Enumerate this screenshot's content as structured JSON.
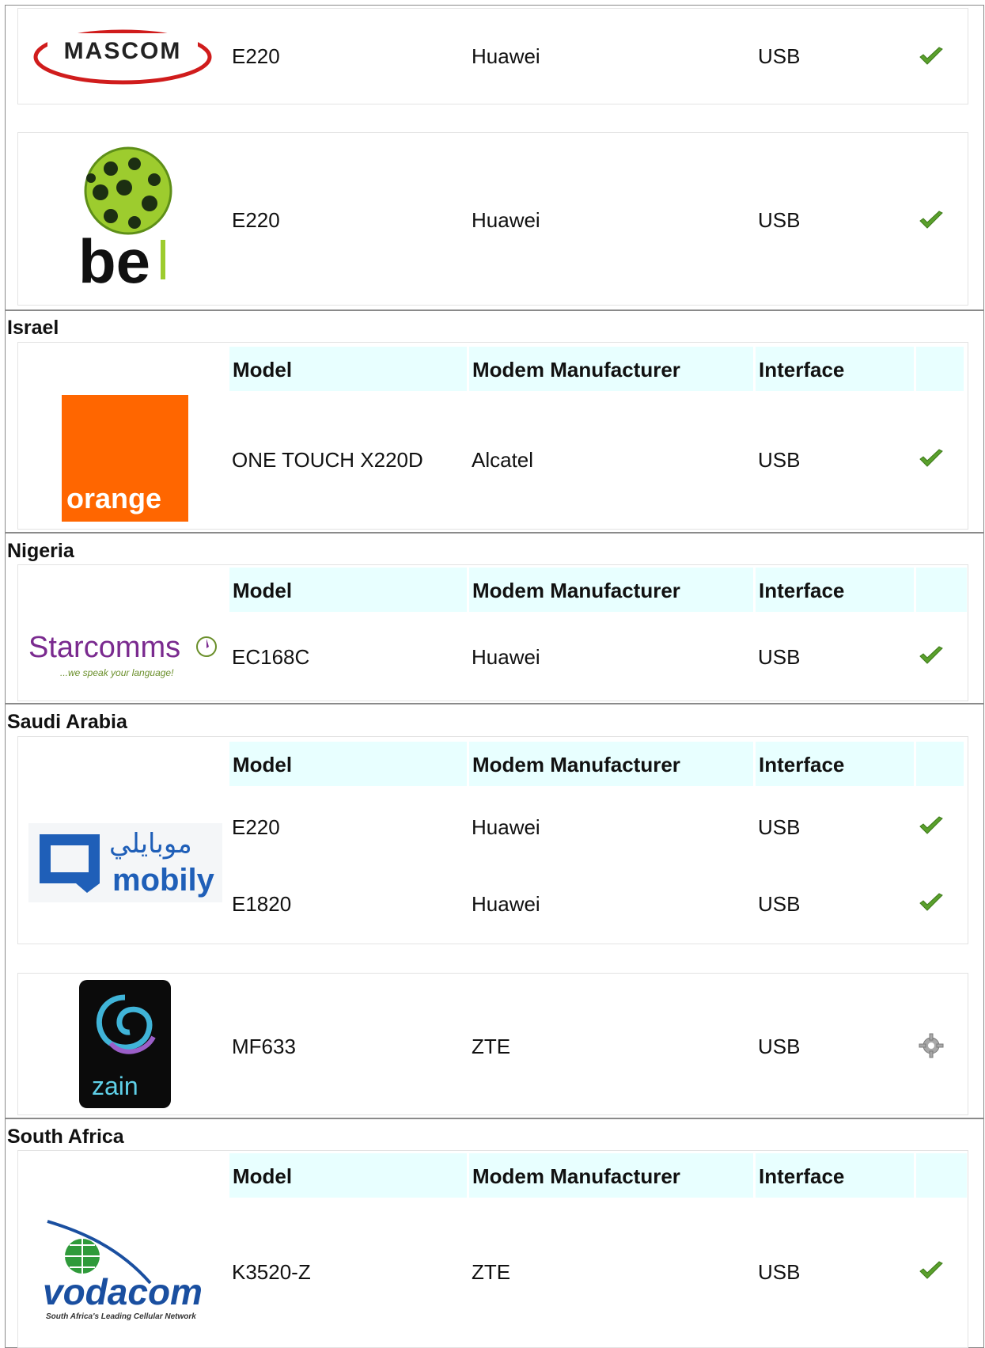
{
  "headers": {
    "model": "Model",
    "manufacturer": "Modem Manufacturer",
    "interface": "Interface"
  },
  "sections": [
    {
      "country": "",
      "providers": [
        {
          "logo": "mascom-logo",
          "logo_text": "MASCOM",
          "rows": [
            {
              "model": "E220",
              "manufacturer": "Huawei",
              "interface": "USB",
              "status": "check-icon"
            }
          ]
        },
        {
          "logo": "be-mobile-logo",
          "logo_text": "be",
          "rows": [
            {
              "model": "E220",
              "manufacturer": "Huawei",
              "interface": "USB",
              "status": "check-icon"
            }
          ]
        }
      ]
    },
    {
      "country": "Israel",
      "providers": [
        {
          "logo": "orange-logo",
          "logo_text": "orange",
          "rows": [
            {
              "model": "ONE TOUCH X220D",
              "manufacturer": "Alcatel",
              "interface": "USB",
              "status": "check-icon"
            }
          ]
        }
      ]
    },
    {
      "country": "Nigeria",
      "providers": [
        {
          "logo": "starcomms-logo",
          "logo_text": "Starcomms",
          "logo_subtext": "...we speak your language!",
          "rows": [
            {
              "model": "EC168C",
              "manufacturer": "Huawei",
              "interface": "USB",
              "status": "check-icon"
            }
          ]
        }
      ]
    },
    {
      "country": "Saudi Arabia",
      "providers": [
        {
          "logo": "mobily-logo",
          "logo_text": "mobily",
          "logo_arabic": "موبايلي",
          "rows": [
            {
              "model": "E220",
              "manufacturer": "Huawei",
              "interface": "USB",
              "status": "check-icon"
            },
            {
              "model": "E1820",
              "manufacturer": "Huawei",
              "interface": "USB",
              "status": "check-icon"
            }
          ]
        },
        {
          "logo": "zain-logo",
          "logo_text": "zain",
          "rows": [
            {
              "model": "MF633",
              "manufacturer": "ZTE",
              "interface": "USB",
              "status": "gear-icon"
            }
          ]
        }
      ]
    },
    {
      "country": "South Africa",
      "providers": [
        {
          "logo": "vodacom-logo",
          "logo_text": "vodacom",
          "logo_subtext": "South Africa's Leading Cellular Network",
          "rows": [
            {
              "model": "K3520-Z",
              "manufacturer": "ZTE",
              "interface": "USB",
              "status": "check-icon"
            }
          ]
        }
      ]
    }
  ],
  "colors": {
    "header_bg": "#e8ffff",
    "check_green": "#5aa02c",
    "orange": "#ff6600",
    "starcomms_purple": "#7a2a8f",
    "mobily_blue": "#1f5fb8",
    "vodacom_blue": "#1a4fa0"
  }
}
